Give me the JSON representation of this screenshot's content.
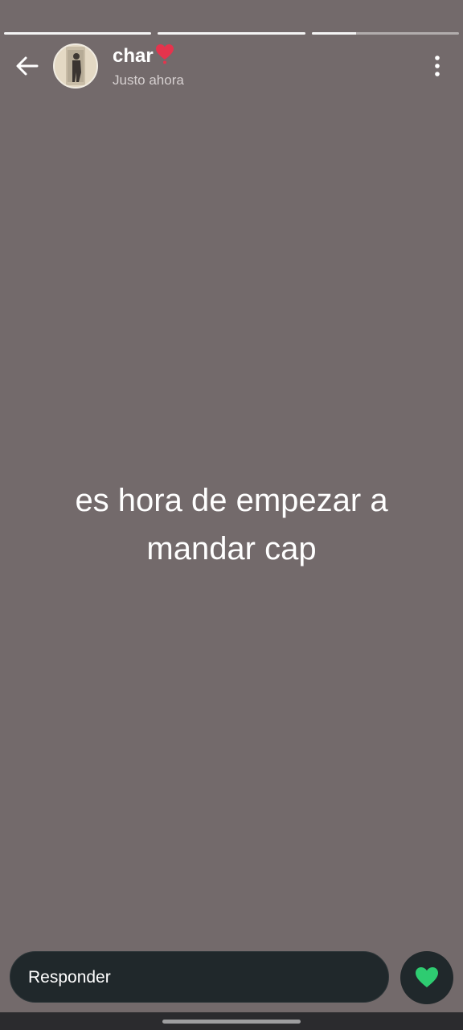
{
  "story": {
    "progress": [
      1.0,
      1.0,
      0.3
    ],
    "text": "es hora de empezar a mandar cap"
  },
  "header": {
    "username": "char",
    "username_emoji": "heart-emoji-icon",
    "timestamp": "Justo ahora",
    "back_icon": "arrow-left-icon",
    "menu_icon": "more-vertical-icon"
  },
  "reply": {
    "placeholder": "Responder",
    "like_icon": "heart-icon",
    "like_color": "#2ecc71"
  },
  "colors": {
    "background": "#736a6b",
    "input_bg": "#20282b"
  }
}
